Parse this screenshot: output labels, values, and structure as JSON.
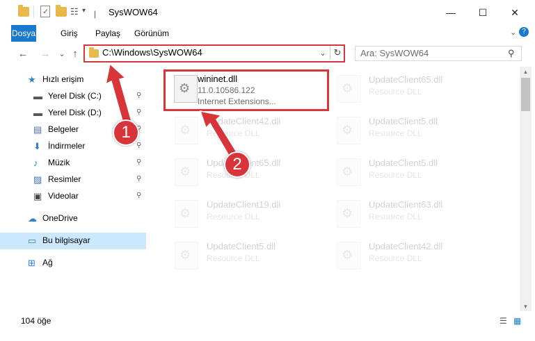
{
  "window": {
    "title": "SysWOW64",
    "controls": {
      "minimize": "—",
      "maximize": "☐",
      "close": "✕"
    }
  },
  "ribbon": {
    "tabs": [
      {
        "label": "Dosya",
        "active": true
      },
      {
        "label": "Giriş"
      },
      {
        "label": "Paylaş"
      },
      {
        "label": "Görünüm"
      }
    ],
    "help": "?"
  },
  "address": {
    "path": "C:\\Windows\\SysWOW64",
    "search_placeholder": "Ara: SysWOW64",
    "icons": {
      "back": "←",
      "forward": "→",
      "recent": "⌄",
      "up": "↑",
      "dropdown": "⌄",
      "refresh": "↻",
      "search": "⚲"
    }
  },
  "nav": {
    "items": [
      {
        "label": "Hızlı erişim",
        "icon": "star-icon",
        "glyph": "★",
        "color": "#2d7fd2"
      },
      {
        "label": "Yerel Disk (C:)",
        "icon": "drive-icon",
        "glyph": "▬",
        "color": "#555555",
        "pinned": true
      },
      {
        "label": "Yerel Disk (D:)",
        "icon": "drive-icon",
        "glyph": "▬",
        "color": "#555555",
        "pinned": true
      },
      {
        "label": "Belgeler",
        "icon": "documents-icon",
        "glyph": "▤",
        "color": "#4a6fa5",
        "pinned": true
      },
      {
        "label": "İndirmeler",
        "icon": "download-icon",
        "glyph": "⬇",
        "color": "#2d7fd2",
        "pinned": true
      },
      {
        "label": "Müzik",
        "icon": "music-icon",
        "glyph": "♪",
        "color": "#2d7fd2",
        "pinned": true
      },
      {
        "label": "Resimler",
        "icon": "pictures-icon",
        "glyph": "▨",
        "color": "#3b78c2",
        "pinned": true
      },
      {
        "label": "Videolar",
        "icon": "video-icon",
        "glyph": "▣",
        "color": "#444444",
        "pinned": true
      },
      {
        "label": "OneDrive",
        "icon": "cloud-icon",
        "glyph": "☁",
        "color": "#2d7fd2"
      },
      {
        "label": "Bu bilgisayar",
        "icon": "computer-icon",
        "glyph": "▭",
        "color": "#2d7fd2",
        "selected": true
      },
      {
        "label": "Ağ",
        "icon": "network-icon",
        "glyph": "⊞",
        "color": "#2d7fd2"
      }
    ],
    "pin_glyph": "📌"
  },
  "files": [
    {
      "name": "wininet.dll",
      "version": "11.0.10586.122",
      "description": "Internet Extensions...",
      "highlighted": true
    },
    {
      "name": "UpdateClient65.dll",
      "version": "Resource DLL",
      "description": ""
    },
    {
      "name": "UpdateClient42.dll",
      "version": "Resource DLL",
      "description": ""
    },
    {
      "name": "UpdateClient5.dll",
      "version": "Resource DLL",
      "description": ""
    },
    {
      "name": "UpdateClient65.dll",
      "version": "Resource DLL",
      "description": ""
    },
    {
      "name": "UpdateClient5.dll",
      "version": "Resource DLL",
      "description": ""
    },
    {
      "name": "UpdateClient19.dll",
      "version": "Resource DLL",
      "description": ""
    },
    {
      "name": "UpdateClient63.dll",
      "version": "Resource DLL",
      "description": ""
    },
    {
      "name": "UpdateClient5.dll",
      "version": "Resource DLL",
      "description": ""
    },
    {
      "name": "UpdateClient42.dll",
      "version": "Resource DLL",
      "description": ""
    }
  ],
  "status": {
    "item_count": "104 öğe",
    "view_icons": {
      "details": "☰",
      "tiles": "▦"
    }
  },
  "annotations": {
    "badge1": "1",
    "badge2": "2",
    "color": "#d8353a"
  }
}
